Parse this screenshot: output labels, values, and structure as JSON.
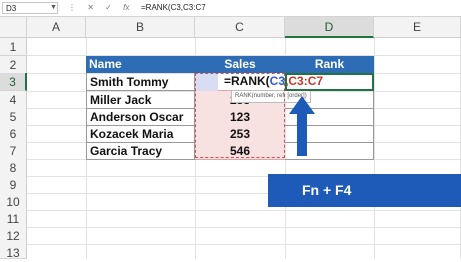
{
  "formula_bar": {
    "name_box": "D3",
    "name_box_arrow": "▼",
    "icons": [
      "⋮",
      "✕",
      "✓",
      "fx"
    ],
    "formula": "=RANK(C3,C3:C7"
  },
  "columns": [
    "",
    "A",
    "B",
    "C",
    "D",
    "E"
  ],
  "rows": [
    "1",
    "2",
    "3",
    "4",
    "5",
    "6",
    "7",
    "8",
    "9",
    "10",
    "11",
    "12",
    "13"
  ],
  "table": {
    "headers": [
      "Name",
      "Sales",
      "Rank"
    ],
    "rows": [
      {
        "name": "Smith Tommy",
        "sales": ""
      },
      {
        "name": "Miller Jack",
        "sales": "258"
      },
      {
        "name": "Anderson Oscar",
        "sales": "123"
      },
      {
        "name": "Kozacek Maria",
        "sales": "253"
      },
      {
        "name": "Garcia Tracy",
        "sales": "546"
      }
    ]
  },
  "cell_formula": {
    "prefix": "=RANK(",
    "ref1": "C3",
    "comma": ",",
    "ref2": "C3:C7",
    "ref1_color": "#2e5cd6",
    "ref2_color": "#c0392b"
  },
  "tooltip": "RANK(number, ref, [order])",
  "banner": {
    "text": "Fn + F4",
    "color": "#1e5bb8"
  },
  "arrow_color": "#1e5bb8",
  "accent": "#217346",
  "header_blue": "#2e6db6"
}
